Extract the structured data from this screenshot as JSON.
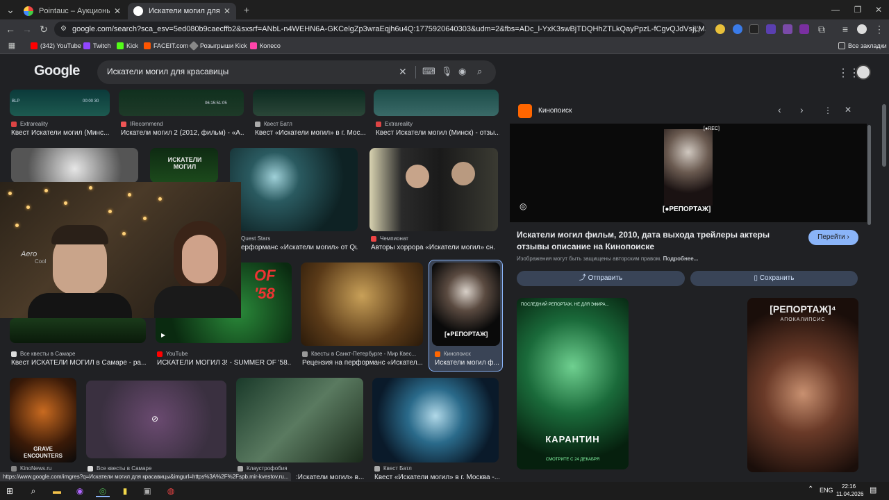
{
  "browser": {
    "tabs": [
      {
        "title": "Pointauc – Аукционы, лотереи",
        "active": false
      },
      {
        "title": "Искатели могил для красавиц",
        "active": true
      }
    ],
    "url": "google.com/search?sca_esv=5ed080b9caecffb2&sxsrf=ANbL-n4WEHN6A-GKCelgZp3wraEqjh6u4Q:1775920640303&udm=2&fbs=ADc_l-YxK3swBjTDQHhZTLkQayPpzL-fCgvQJdVsjLM3XmPXz_Q8TTdRdCKSRBDXfIE...",
    "bookmarks": [
      "(342) YouTube",
      "Twitch",
      "Kick",
      "FACEIT.com",
      "Розыгрыши Kick",
      "Колесо"
    ],
    "all_bookmarks": "Все закладки",
    "status_url": "https://www.google.com/imgres?q=Искатели могил для красавицы&imgurl=https%3A%2F%2Fspb.mir-kvestov.ru..."
  },
  "google": {
    "logo": "Google",
    "query": "Искатели могил для красавицы"
  },
  "grid": {
    "row1": [
      {
        "source": "Extrareality",
        "title": "Квест Искатели могил (Минс..."
      },
      {
        "source": "IRecommend",
        "title": "Искатели могил 2 (2012, фильм) - «А..."
      },
      {
        "source": "Квест Батл",
        "title": "Квест «Искатели могил» в г. Мос..."
      },
      {
        "source": "Extrareality",
        "title": "Квест Искатели могил (Минск) - отзы..."
      }
    ],
    "row2": [
      {
        "source": "Quest Stars",
        "title": "ерформанс «Искатели могил» от Qu..."
      },
      {
        "source": "Чемпионат",
        "title": "Авторы хоррора «Искатели могил» сн..."
      }
    ],
    "row3": [
      {
        "source": "Все квесты в Самаре",
        "title": "Квест ИСКАТЕЛИ МОГИЛ в Самаре - ра..."
      },
      {
        "source": "YouTube",
        "title": "ИСКАТЕЛИ МОГИЛ 3! - SUMMER OF '58..."
      },
      {
        "source": "Квесты в Санкт-Петербурге - Мир Квес...",
        "title": "Рецензия на перформанс «Искател..."
      },
      {
        "source": "Кинопоиск",
        "title": "Искатели могил ф..."
      }
    ],
    "row4": [
      {
        "source": "KinoNews.ru",
        "title": ""
      },
      {
        "source": "Все квесты в Самаре",
        "title": ""
      },
      {
        "source": "Клаустрофобия",
        "title": ":Искатели могил» в..."
      },
      {
        "source": "Квест Батл",
        "title": "Квест «Искатели могил» в г. Москва -..."
      }
    ],
    "thumb_texts": {
      "search_poster": "ИСКАТЕЛИ МОГИЛ",
      "summer58": "OF '58",
      "report_poster": "[●РЕПОРТАЖ]",
      "grave_encounters": "GRAVE ENCOUNTERS",
      "cam_timestamp": "06:15:51:05",
      "cam_overlay": "BLP",
      "cam_overlay_time": "00:00 30"
    }
  },
  "panel": {
    "site": "Кинопоиск",
    "title": "Искатели могил фильм, 2010, дата выхода трейлеры актеры отзывы описание на Кинопоиске",
    "go_label": "Перейти",
    "copyright": "Изображения могут быть защищены авторским правом.",
    "more": "Подробнее...",
    "share_label": "Отправить",
    "save_label": "Сохранить",
    "preview_tag": "[●REC]",
    "preview_report": "[●РЕПОРТАЖ]",
    "related1_top": "ПОСЛЕДНИЙ РЕПОРТАЖ. НЕ ДЛЯ ЭФИРА...",
    "related1_title": "КАРАНТИН",
    "related1_bottom": "СМОТРИТЕ С 24 ДЕКАБРЯ",
    "related2_title": "[РЕПОРТАЖ]⁴",
    "related2_sub": "АПОКАЛИПСИС"
  },
  "webcam": {
    "brand": "Aero",
    "brand2": "Cool"
  },
  "taskbar": {
    "lang": "ENG",
    "time": "22:16",
    "date": "11.04.2026"
  }
}
